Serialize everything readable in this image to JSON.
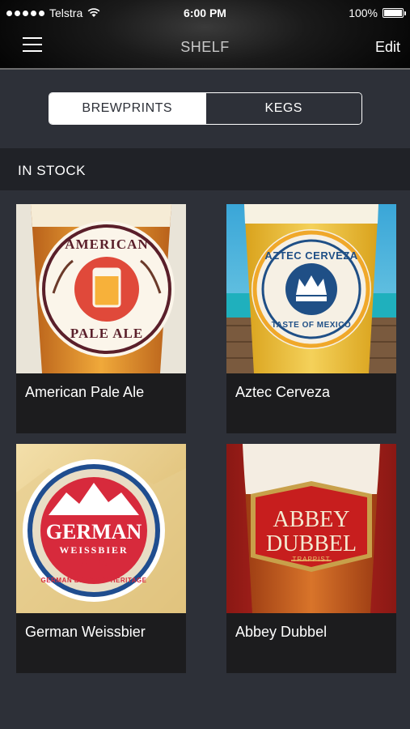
{
  "status_bar": {
    "carrier": "Telstra",
    "time": "6:00 PM",
    "battery": "100%"
  },
  "navbar": {
    "title": "SHELF",
    "edit_label": "Edit"
  },
  "segmented": {
    "tabs": [
      {
        "label": "BREWPRINTS",
        "selected": true
      },
      {
        "label": "KEGS",
        "selected": false
      }
    ]
  },
  "section": {
    "title": "IN STOCK"
  },
  "items": [
    {
      "name": "American Pale Ale",
      "badge_line1": "AMERICAN",
      "badge_line2": "PALE ALE"
    },
    {
      "name": "Aztec Cerveza",
      "badge_line1": "AZTEC CERVEZA",
      "badge_line2": "TASTE OF MEXICO"
    },
    {
      "name": "German Weissbier",
      "badge_line1": "GERMAN",
      "badge_line2": "WEISSBIER",
      "badge_line3": "GERMAN BREWING HERITAGE"
    },
    {
      "name": "Abbey Dubbel",
      "badge_line1": "ABBEY",
      "badge_line2": "DUBBEL",
      "badge_line3": "TRAPPIST"
    }
  ],
  "colors": {
    "background": "#2d3038",
    "section_bg": "#202227",
    "card_bg": "#1c1c1e"
  }
}
